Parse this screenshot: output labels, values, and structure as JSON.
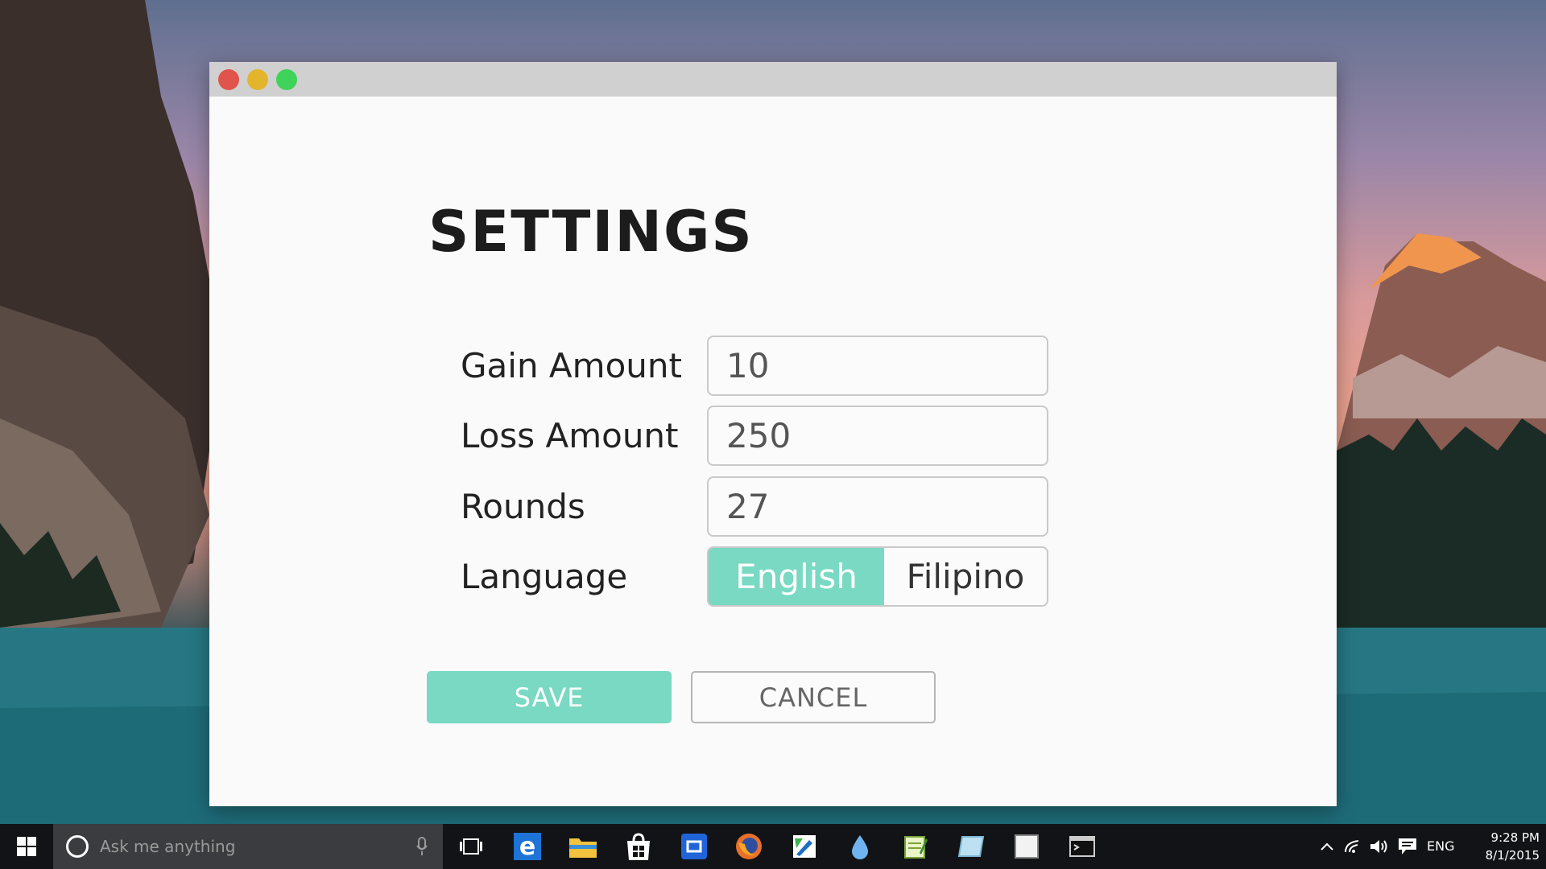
{
  "window": {
    "controls": [
      "close",
      "minimize",
      "maximize"
    ]
  },
  "settings": {
    "title": "SETTINGS",
    "gain": {
      "label": "Gain Amount",
      "value": "10"
    },
    "loss": {
      "label": "Loss Amount",
      "value": "250"
    },
    "rounds": {
      "label": "Rounds",
      "value": "27"
    },
    "language": {
      "label": "Language",
      "options": [
        "English",
        "Filipino"
      ],
      "selected": "English"
    },
    "save_label": "SAVE",
    "cancel_label": "CANCEL"
  },
  "taskbar": {
    "search_placeholder": "Ask me anything",
    "pinned_icons": [
      "task-view-icon",
      "edge-icon",
      "file-explorer-icon",
      "store-icon",
      "app-tile-icon",
      "firefox-icon",
      "pen-app-icon",
      "water-drop-icon",
      "notepad-icon",
      "tablet-app-icon",
      "blank-app-icon",
      "terminal-icon"
    ],
    "tray": {
      "icons": [
        "chevron-up-icon",
        "wifi-icon",
        "volume-icon",
        "notification-icon"
      ],
      "language": "ENG",
      "time": "9:28 PM",
      "date": "8/1/2015"
    }
  },
  "colors": {
    "accent": "#79d9c3",
    "close": "#e0544b",
    "minimize": "#e2b52d",
    "maximize": "#3fd35a",
    "taskbar": "#111316"
  }
}
